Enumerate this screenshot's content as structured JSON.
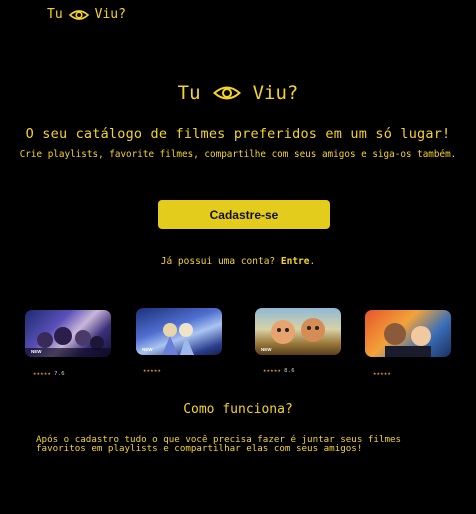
{
  "brand": {
    "left": "Tu",
    "right": "Viu?",
    "icon": "eye-icon"
  },
  "hero": {
    "headline": "O seu catálogo de filmes preferidos em um só lugar!",
    "subline": "Crie playlists, favorite filmes, compartilhe com seus amigos e siga-os também."
  },
  "cta": {
    "label": "Cadastre-se"
  },
  "login": {
    "prompt": "Já possui uma conta?",
    "link": "Entre",
    "suffix": "."
  },
  "movies": [
    {
      "tag": "NEW",
      "stars": "★★★★★",
      "score": "7.6",
      "rating": 4.5
    },
    {
      "tag": "NEW",
      "stars": "★★★★★",
      "score": "",
      "rating": 4
    },
    {
      "tag": "NEW",
      "stars": "★★★★★",
      "score": "8.6",
      "rating": 4.5
    },
    {
      "tag": "",
      "stars": "★★★★★",
      "score": "",
      "rating": 4
    }
  ],
  "how": {
    "title": "Como funciona?",
    "text": "Após o cadastro tudo o que você precisa fazer é juntar seus filmes favoritos em playlists e compartilhar elas com seus amigos!"
  },
  "colors": {
    "accent": "#f5d524",
    "button": "#e3cc1c",
    "background": "#000000"
  }
}
